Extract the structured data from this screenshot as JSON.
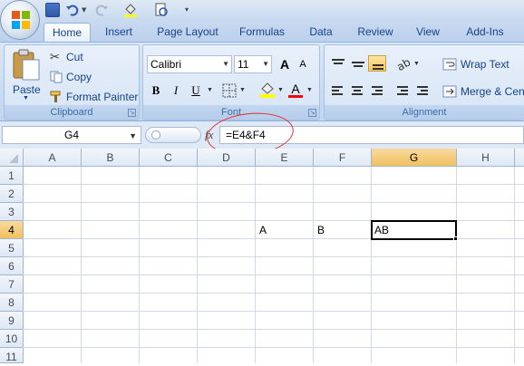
{
  "ribbon_tabs": [
    "Home",
    "Insert",
    "Page Layout",
    "Formulas",
    "Data",
    "Review",
    "View",
    "Add-Ins"
  ],
  "active_tab": "Home",
  "clipboard": {
    "paste_label": "Paste",
    "cut_label": "Cut",
    "copy_label": "Copy",
    "format_painter_label": "Format Painter",
    "group_label": "Clipboard"
  },
  "font": {
    "family": "Calibri",
    "size": "11",
    "bold": "B",
    "italic": "I",
    "underline": "U",
    "grow": "A",
    "shrink": "A",
    "font_color": "A",
    "group_label": "Font",
    "font_color_hex": "#ff0000",
    "fill_color_hex": "#ffff00"
  },
  "alignment": {
    "wrap_text_label": "Wrap Text",
    "merge_label": "Merge & Center",
    "group_label": "Alignment"
  },
  "formula_bar": {
    "name_box": "G4",
    "fx": "fx",
    "formula": "=E4&F4"
  },
  "sheet": {
    "columns": [
      "A",
      "B",
      "C",
      "D",
      "E",
      "F",
      "G",
      "H"
    ],
    "rows": [
      "1",
      "2",
      "3",
      "4",
      "5",
      "6",
      "7",
      "8",
      "9",
      "10",
      "11"
    ],
    "selected_column": "G",
    "selected_row": "4",
    "cells": {
      "E4": "A",
      "F4": "B",
      "G4": "AB"
    }
  },
  "colors": {
    "accent": "#15428b",
    "annotation": "#e03030",
    "selection_header": "#f1c15f"
  }
}
